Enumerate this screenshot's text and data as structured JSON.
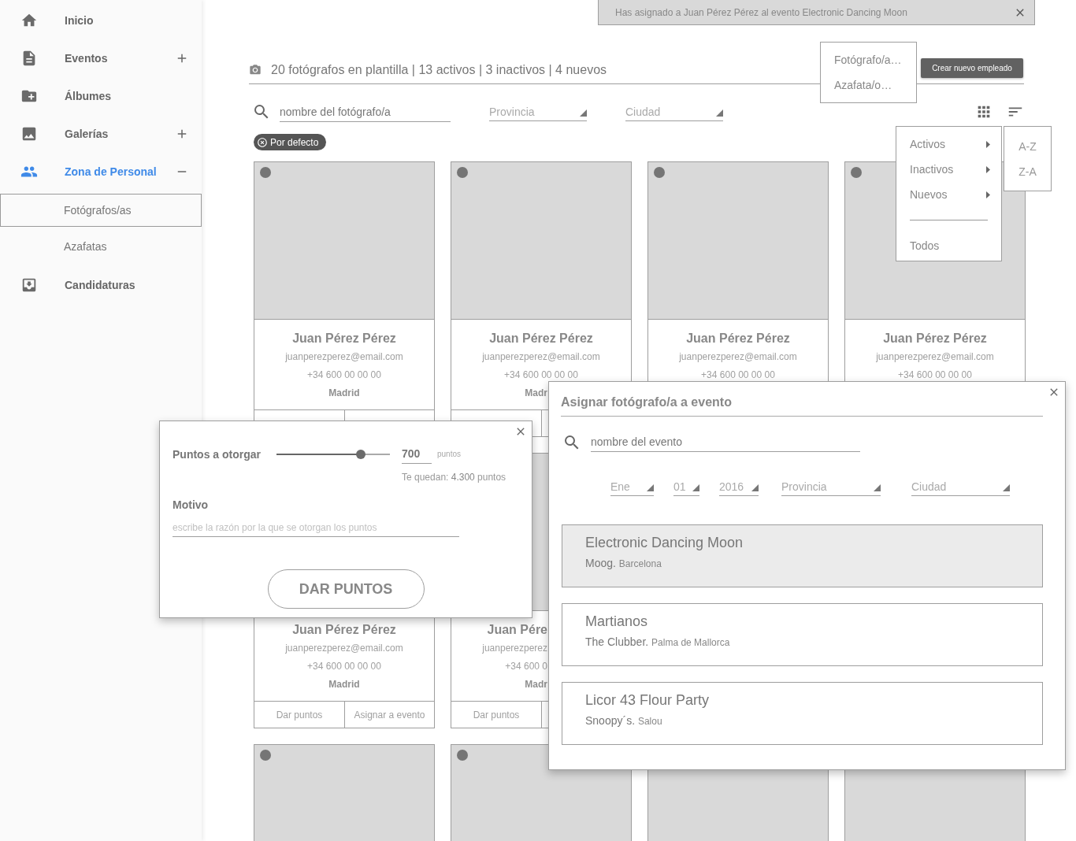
{
  "sidebar": {
    "items": [
      {
        "label": "Inicio",
        "selected": false
      },
      {
        "label": "Eventos",
        "selected": false,
        "expanded": false
      },
      {
        "label": "Álbumes",
        "selected": false
      },
      {
        "label": "Galerías",
        "selected": false,
        "expanded": false
      },
      {
        "label": "Zona de Personal",
        "selected": true,
        "expanded": true,
        "children": [
          {
            "label": "Fotógrafos/as",
            "selected": true
          },
          {
            "label": "Azafatas",
            "selected": false
          }
        ]
      },
      {
        "label": "Candidaturas",
        "selected": false
      }
    ]
  },
  "toast": {
    "message": "Has asignado a Juan Pérez Pérez al evento Electronic Dancing Moon"
  },
  "header": {
    "summary": "20 fotógrafos en plantilla | 13 activos | 3 inactivos | 4 nuevos",
    "create_button": "Crear nuevo empleado"
  },
  "role_menu": {
    "items": [
      "Fotógrafo/a…",
      "Azafata/o…"
    ]
  },
  "filters": {
    "search_placeholder": "nombre del fotógrafo/a",
    "selects": [
      "Provincia",
      "Ciudad"
    ],
    "chips": [
      "Por defecto"
    ]
  },
  "filter_menu": {
    "items": [
      {
        "kind": "submenu",
        "label": "Activos"
      },
      {
        "kind": "submenu",
        "label": "Inactivos"
      },
      {
        "kind": "submenu",
        "label": "Nuevos"
      },
      {
        "kind": "divider"
      },
      {
        "kind": "plain",
        "label": "Todos"
      }
    ]
  },
  "sort_menu": {
    "items": [
      "A-Z",
      "Z-A"
    ]
  },
  "cards": [
    {
      "status_dot": true,
      "lines": [
        {
          "kind": "name",
          "text": "Juan Pérez Pérez",
          "cut": false
        },
        {
          "kind": "email",
          "text": "juanperezperez@email.com",
          "cut": false
        },
        {
          "kind": "phone",
          "text": "+34 600 00 00 00",
          "cut": false
        },
        {
          "kind": "city",
          "text": "Madrid",
          "cut": false
        }
      ]
    },
    {
      "status_dot": true,
      "lines": [
        {
          "kind": "name",
          "text": "Juan Pérez Pérez",
          "cut": false
        },
        {
          "kind": "email",
          "text": "juanperezperez@email.com",
          "cut": false
        },
        {
          "kind": "phone",
          "text": "+34 600 00 00 00",
          "cut": false
        },
        {
          "kind": "city",
          "text": "Madr",
          "cut": true
        }
      ]
    },
    {
      "status_dot": true,
      "lines": [
        {
          "kind": "name",
          "text": "Juan Pérez Pérez",
          "cut": false
        },
        {
          "kind": "email",
          "text": "juanperezperez@email.com",
          "cut": false
        },
        {
          "kind": "phone",
          "text": "+34 600 00 00 00",
          "cut": false
        }
      ]
    },
    {
      "status_dot": true,
      "lines": [
        {
          "kind": "name",
          "text": "Juan Pérez Pérez",
          "cut": false
        },
        {
          "kind": "email",
          "text": "juanperezperez@email.com",
          "cut": false
        },
        {
          "kind": "phone",
          "text": "+34 600 00 00 00",
          "cut": false
        }
      ]
    },
    {
      "lines": [
        {
          "kind": "name",
          "text": "Juan Pérez Pérez",
          "cut": false
        },
        {
          "kind": "email",
          "text": "juanperezperez@email.com",
          "cut": false
        },
        {
          "kind": "phone",
          "text": "+34 600 00 00 00",
          "cut": false
        },
        {
          "kind": "city",
          "text": "Madrid",
          "cut": false
        }
      ],
      "actions": [
        "Dar puntos",
        "Asignar a evento"
      ]
    },
    {
      "status_dot": false,
      "lines": [
        {
          "kind": "name",
          "text": "Juan Pére",
          "cut": true
        },
        {
          "kind": "email",
          "text": "juanperezperez",
          "cut": true
        },
        {
          "kind": "phone",
          "text": "+34 600 0",
          "cut": true
        },
        {
          "kind": "city",
          "text": "Madr",
          "cut": true
        }
      ],
      "actions": [
        "Dar puntos"
      ]
    },
    {
      "status_dot": true
    },
    {
      "status_dot": true
    },
    {
      "status_dot": false
    },
    {
      "status_dot": false
    }
  ],
  "points_dialog": {
    "label": "Puntos a otorgar",
    "level": 0.74,
    "value": "700",
    "unit": "puntos",
    "remaining": "Te quedan: **4.300** puntos",
    "reason_label": "Motivo",
    "reason_placeholder": "escribe la razón por la que se otorgan los puntos",
    "submit": "DAR PUNTOS"
  },
  "assign_dialog": {
    "title": "Asignar fotógrafo/a a evento",
    "search_placeholder": "nombre del evento",
    "selects": [
      "Ene",
      "01",
      "2016",
      "Provincia",
      "Ciudad"
    ],
    "events": [
      {
        "name": "Electronic Dancing Moon",
        "venue": "Moog.",
        "city": "Barcelona",
        "selected": true
      },
      {
        "name": "Martianos",
        "venue": "The Clubber.",
        "city": "Palma de Mallorca",
        "selected": false
      },
      {
        "name": "Licor 43 Flour Party",
        "venue": "Snoopy´s.",
        "city": "Salou",
        "selected": false
      }
    ]
  }
}
